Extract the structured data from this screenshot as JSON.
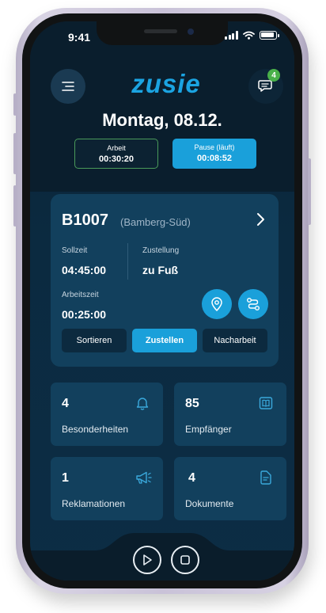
{
  "status_bar": {
    "time": "9:41"
  },
  "header": {
    "logo_text": "zusie",
    "date": "Montag, 08.12.",
    "notification_count": "4"
  },
  "timers": {
    "work": {
      "label": "Arbeit",
      "value": "00:30:20"
    },
    "pause": {
      "label": "Pause (läuft)",
      "value": "00:08:52"
    }
  },
  "tour": {
    "id": "B1007",
    "area": "(Bamberg-Süd)",
    "target_time_label": "Sollzeit",
    "target_time_value": "04:45:00",
    "delivery_label": "Zustellung",
    "delivery_value": "zu Fuß",
    "work_time_label": "Arbeitszeit",
    "work_time_value": "00:25:00",
    "actions": {
      "sort": "Sortieren",
      "deliver": "Zustellen",
      "rework": "Nacharbeit"
    }
  },
  "tiles": [
    {
      "count": "4",
      "label": "Besonderheiten",
      "icon": "bell-icon"
    },
    {
      "count": "85",
      "label": "Empfänger",
      "icon": "book-icon"
    },
    {
      "count": "1",
      "label": "Reklamationen",
      "icon": "megaphone-icon"
    },
    {
      "count": "4",
      "label": "Dokumente",
      "icon": "document-icon"
    }
  ],
  "colors": {
    "accent": "#1aa0da",
    "background": "#0b2a40",
    "card": "#12405d",
    "badge": "#49b04a",
    "work_border": "#4a9a5a"
  }
}
